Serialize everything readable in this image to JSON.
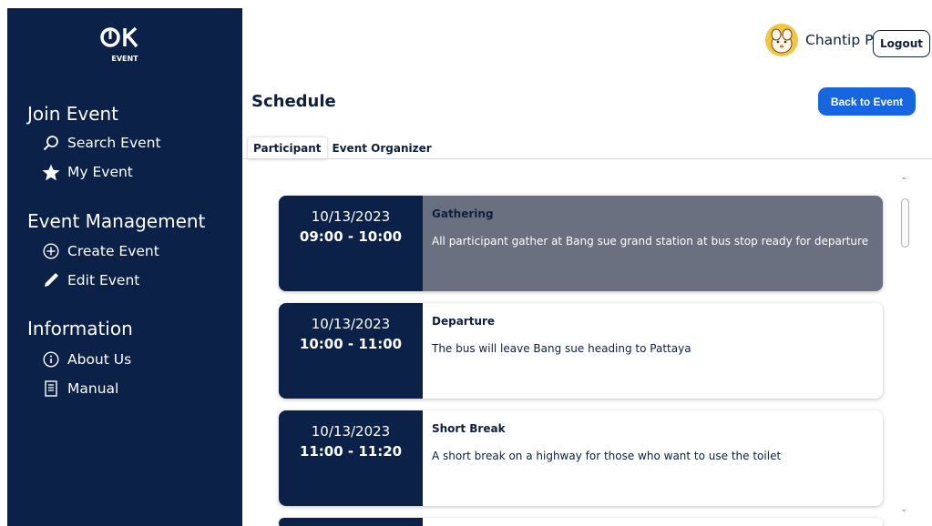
{
  "brand": {
    "mark": "OK",
    "sub": "EVENT"
  },
  "sidebar": {
    "sections": [
      {
        "title": "Join Event",
        "items": [
          {
            "label": "Search Event",
            "icon": "search-icon"
          },
          {
            "label": "My Event",
            "icon": "star-icon"
          }
        ]
      },
      {
        "title": "Event Management",
        "items": [
          {
            "label": "Create Event",
            "icon": "plus-circle-icon"
          },
          {
            "label": "Edit Event",
            "icon": "pencil-icon"
          }
        ]
      },
      {
        "title": "Information",
        "items": [
          {
            "label": "About Us",
            "icon": "info-circle-icon"
          },
          {
            "label": "Manual",
            "icon": "document-icon"
          }
        ]
      }
    ]
  },
  "header": {
    "user_name": "Chantip P.",
    "logout_label": "Logout"
  },
  "page": {
    "title": "Schedule",
    "back_label": "Back to Event",
    "tabs": [
      {
        "label": "Participant",
        "active": true
      },
      {
        "label": "Event Organizer",
        "active": false
      }
    ]
  },
  "schedule": [
    {
      "date": "10/13/2023",
      "time": "09:00 - 10:00",
      "title": "Gathering",
      "description": "All participant gather at Bang sue grand station at bus stop ready for departure",
      "current": true
    },
    {
      "date": "10/13/2023",
      "time": "10:00 - 11:00",
      "title": "Departure",
      "description": "The bus will leave Bang sue heading to Pattaya",
      "current": false
    },
    {
      "date": "10/13/2023",
      "time": "11:00 - 11:20",
      "title": "Short Break",
      "description": "A short break on a highway for those who want to use the toilet",
      "current": false
    }
  ],
  "colors": {
    "sidebar": "#0b2147",
    "accent": "#1766e0",
    "current_card": "#6b7080"
  }
}
